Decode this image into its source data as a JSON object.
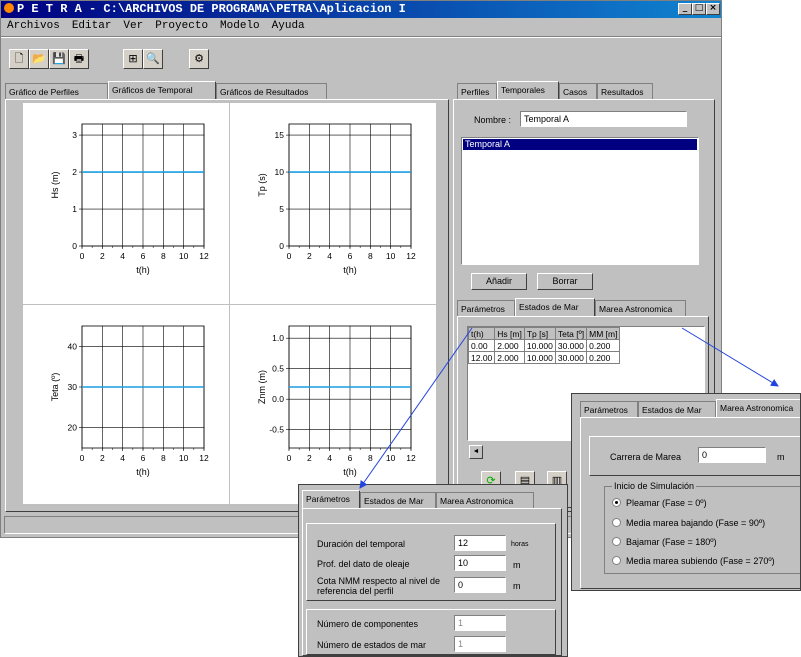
{
  "window": {
    "title": "P E T R A - C:\\ARCHIVOS DE PROGRAMA\\PETRA\\Aplicacion I",
    "controls": [
      "_",
      "□",
      "×"
    ]
  },
  "menu": [
    "Archivos",
    "Editar",
    "Ver",
    "Proyecto",
    "Modelo",
    "Ayuda"
  ],
  "toolbar_icons": [
    "new-file-icon",
    "open-folder-icon",
    "save-icon",
    "print-icon",
    "zoom-in-icon",
    "zoom-icon",
    "settings-gear-icon"
  ],
  "left_tabs": [
    "Gráfico de Perfiles",
    "Gráficos de Temporal",
    "Gráficos de Resultados"
  ],
  "right_tabs": [
    "Perfiles",
    "Temporales",
    "Casos",
    "Resultados"
  ],
  "nombre_label": "Nombre :",
  "nombre_value": "Temporal A",
  "temporal_list": [
    "Temporal A"
  ],
  "anadir_label": "Añadir",
  "borrar_label": "Borrar",
  "sub_tabs": [
    "Parámetros",
    "Estados de Mar",
    "Marea Astronomica"
  ],
  "sea_table": {
    "headers": [
      "t(h)",
      "Hs [m]",
      "Tp [s]",
      "Teta [º]",
      "MM [m]"
    ],
    "rows": [
      [
        "0.00",
        "2.000",
        "10.000",
        "30.000",
        "0.200"
      ],
      [
        "12.00",
        "2.000",
        "10.000",
        "30.000",
        "0.200"
      ]
    ]
  },
  "scroll_left_glyph": "◄",
  "params_popup": {
    "tabs": [
      "Parámetros",
      "Estados de Mar",
      "Marea Astronomica"
    ],
    "fields": [
      {
        "label": "Duración del temporal",
        "value": "12",
        "unit": "horas"
      },
      {
        "label": "Prof. del dato de oleaje",
        "value": "10",
        "unit": "m"
      },
      {
        "label": "Cota NMM respecto al nivel de referencia del perfil",
        "value": "0",
        "unit": "m"
      }
    ],
    "fields2": [
      {
        "label": "Número de componentes",
        "value": "1"
      },
      {
        "label": "Número de estados de mar",
        "value": "1"
      }
    ]
  },
  "marea_popup": {
    "tabs": [
      "Parámetros",
      "Estados de Mar",
      "Marea Astronomica"
    ],
    "carrera_label": "Carrera de Marea",
    "carrera_value": "0",
    "carrera_unit": "m",
    "group_label": "Inicio de Simulación",
    "options": [
      {
        "label": "Pleamar (Fase = 0º)",
        "selected": true
      },
      {
        "label": "Media marea bajando (Fase = 90º)",
        "selected": false
      },
      {
        "label": "Bajamar (Fase = 180º)",
        "selected": false
      },
      {
        "label": "Media marea subiendo (Fase = 270º)",
        "selected": false
      }
    ]
  },
  "colors": {
    "series": "#1a9de0",
    "arrow": "#2244dd",
    "selection": "#000080"
  },
  "chart_data": [
    {
      "type": "line",
      "xlabel": "t(h)",
      "ylabel": "Hs (m)",
      "x_ticks": [
        0,
        2,
        4,
        6,
        8,
        10,
        12
      ],
      "y_ticks": [
        0,
        1,
        2,
        3
      ],
      "y_tick_labels": [
        "0",
        "1",
        "2",
        "3"
      ],
      "ylim": [
        0,
        3.3
      ],
      "xlim": [
        0,
        12
      ],
      "x": [
        0,
        12
      ],
      "y": [
        2,
        2
      ],
      "grid": true
    },
    {
      "type": "line",
      "xlabel": "t(h)",
      "ylabel": "Tp (s)",
      "x_ticks": [
        0,
        2,
        4,
        6,
        8,
        10,
        12
      ],
      "y_ticks": [
        0,
        5,
        10,
        15
      ],
      "y_tick_labels": [
        "0",
        "5",
        "10",
        "15"
      ],
      "ylim": [
        0,
        16.5
      ],
      "xlim": [
        0,
        12
      ],
      "x": [
        0,
        12
      ],
      "y": [
        10,
        10
      ],
      "grid": true
    },
    {
      "type": "line",
      "xlabel": "t(h)",
      "ylabel": "Teta (º)",
      "x_ticks": [
        0,
        2,
        4,
        6,
        8,
        10,
        12
      ],
      "y_ticks": [
        20,
        30,
        40
      ],
      "y_tick_labels": [
        "20",
        "30",
        "40"
      ],
      "ylim": [
        15,
        45
      ],
      "xlim": [
        0,
        12
      ],
      "x": [
        0,
        12
      ],
      "y": [
        30,
        30
      ],
      "grid": true
    },
    {
      "type": "line",
      "xlabel": "t(h)",
      "ylabel": "Znm (m)",
      "x_ticks": [
        0,
        2,
        4,
        6,
        8,
        10,
        12
      ],
      "y_ticks": [
        -0.5,
        0,
        0.5,
        1
      ],
      "y_tick_labels": [
        "-0.5",
        "0.0",
        "0.5",
        "1.0"
      ],
      "ylim": [
        -0.8,
        1.2
      ],
      "xlim": [
        0,
        12
      ],
      "x": [
        0,
        12
      ],
      "y": [
        0.2,
        0.2
      ],
      "grid": true
    }
  ]
}
